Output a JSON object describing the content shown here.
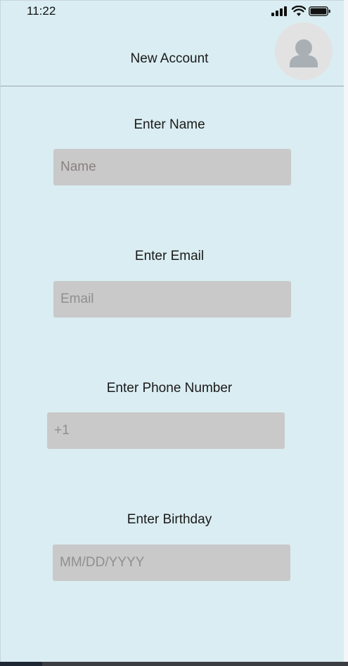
{
  "status_bar": {
    "time": "11:22",
    "icons": [
      "signal-icon",
      "wifi-icon",
      "battery-icon"
    ]
  },
  "header": {
    "title": "New Account",
    "avatar_icon": "user-avatar-icon"
  },
  "form": {
    "name": {
      "label": "Enter Name",
      "placeholder": "Name",
      "value": ""
    },
    "email": {
      "label": "Enter Email",
      "placeholder": "Email",
      "value": ""
    },
    "phone": {
      "label": "Enter Phone Number",
      "placeholder": "+1",
      "value": ""
    },
    "birthday": {
      "label": "Enter Birthday",
      "placeholder": "MM/DD/YYYY",
      "value": ""
    }
  },
  "colors": {
    "background": "#daedf2",
    "input_background": "#c9c9c9",
    "divider": "#9aa7ad",
    "avatar_background": "#e2e2e2",
    "avatar_glyph": "#a9b0b5"
  }
}
